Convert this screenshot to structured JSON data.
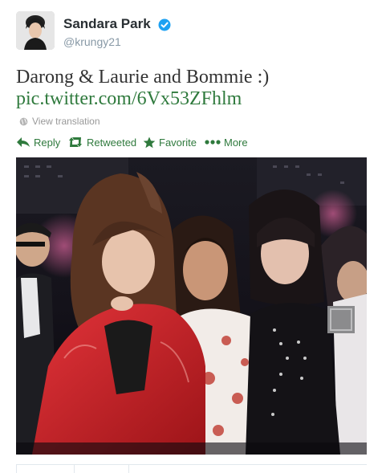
{
  "author": {
    "fullname": "Sandara Park",
    "username": "@krungy21",
    "verified": true,
    "avatar": "avatar"
  },
  "tweet": {
    "text": "Darong & Laurie and Bommie :)",
    "link": "pic.twitter.com/6Vx53ZFhlm"
  },
  "translation": {
    "icon": "globe-icon",
    "label": "View translation"
  },
  "actions": {
    "reply": {
      "icon": "reply-icon",
      "label": "Reply"
    },
    "retweet": {
      "icon": "retweet-icon",
      "label": "Retweeted"
    },
    "favorite": {
      "icon": "star-icon",
      "label": "Favorite"
    },
    "more": {
      "icon": "more-icon",
      "label": "More"
    }
  },
  "colors": {
    "link_green": "#2f7a3d",
    "verified_blue": "#1da1f2",
    "muted": "#999999"
  }
}
